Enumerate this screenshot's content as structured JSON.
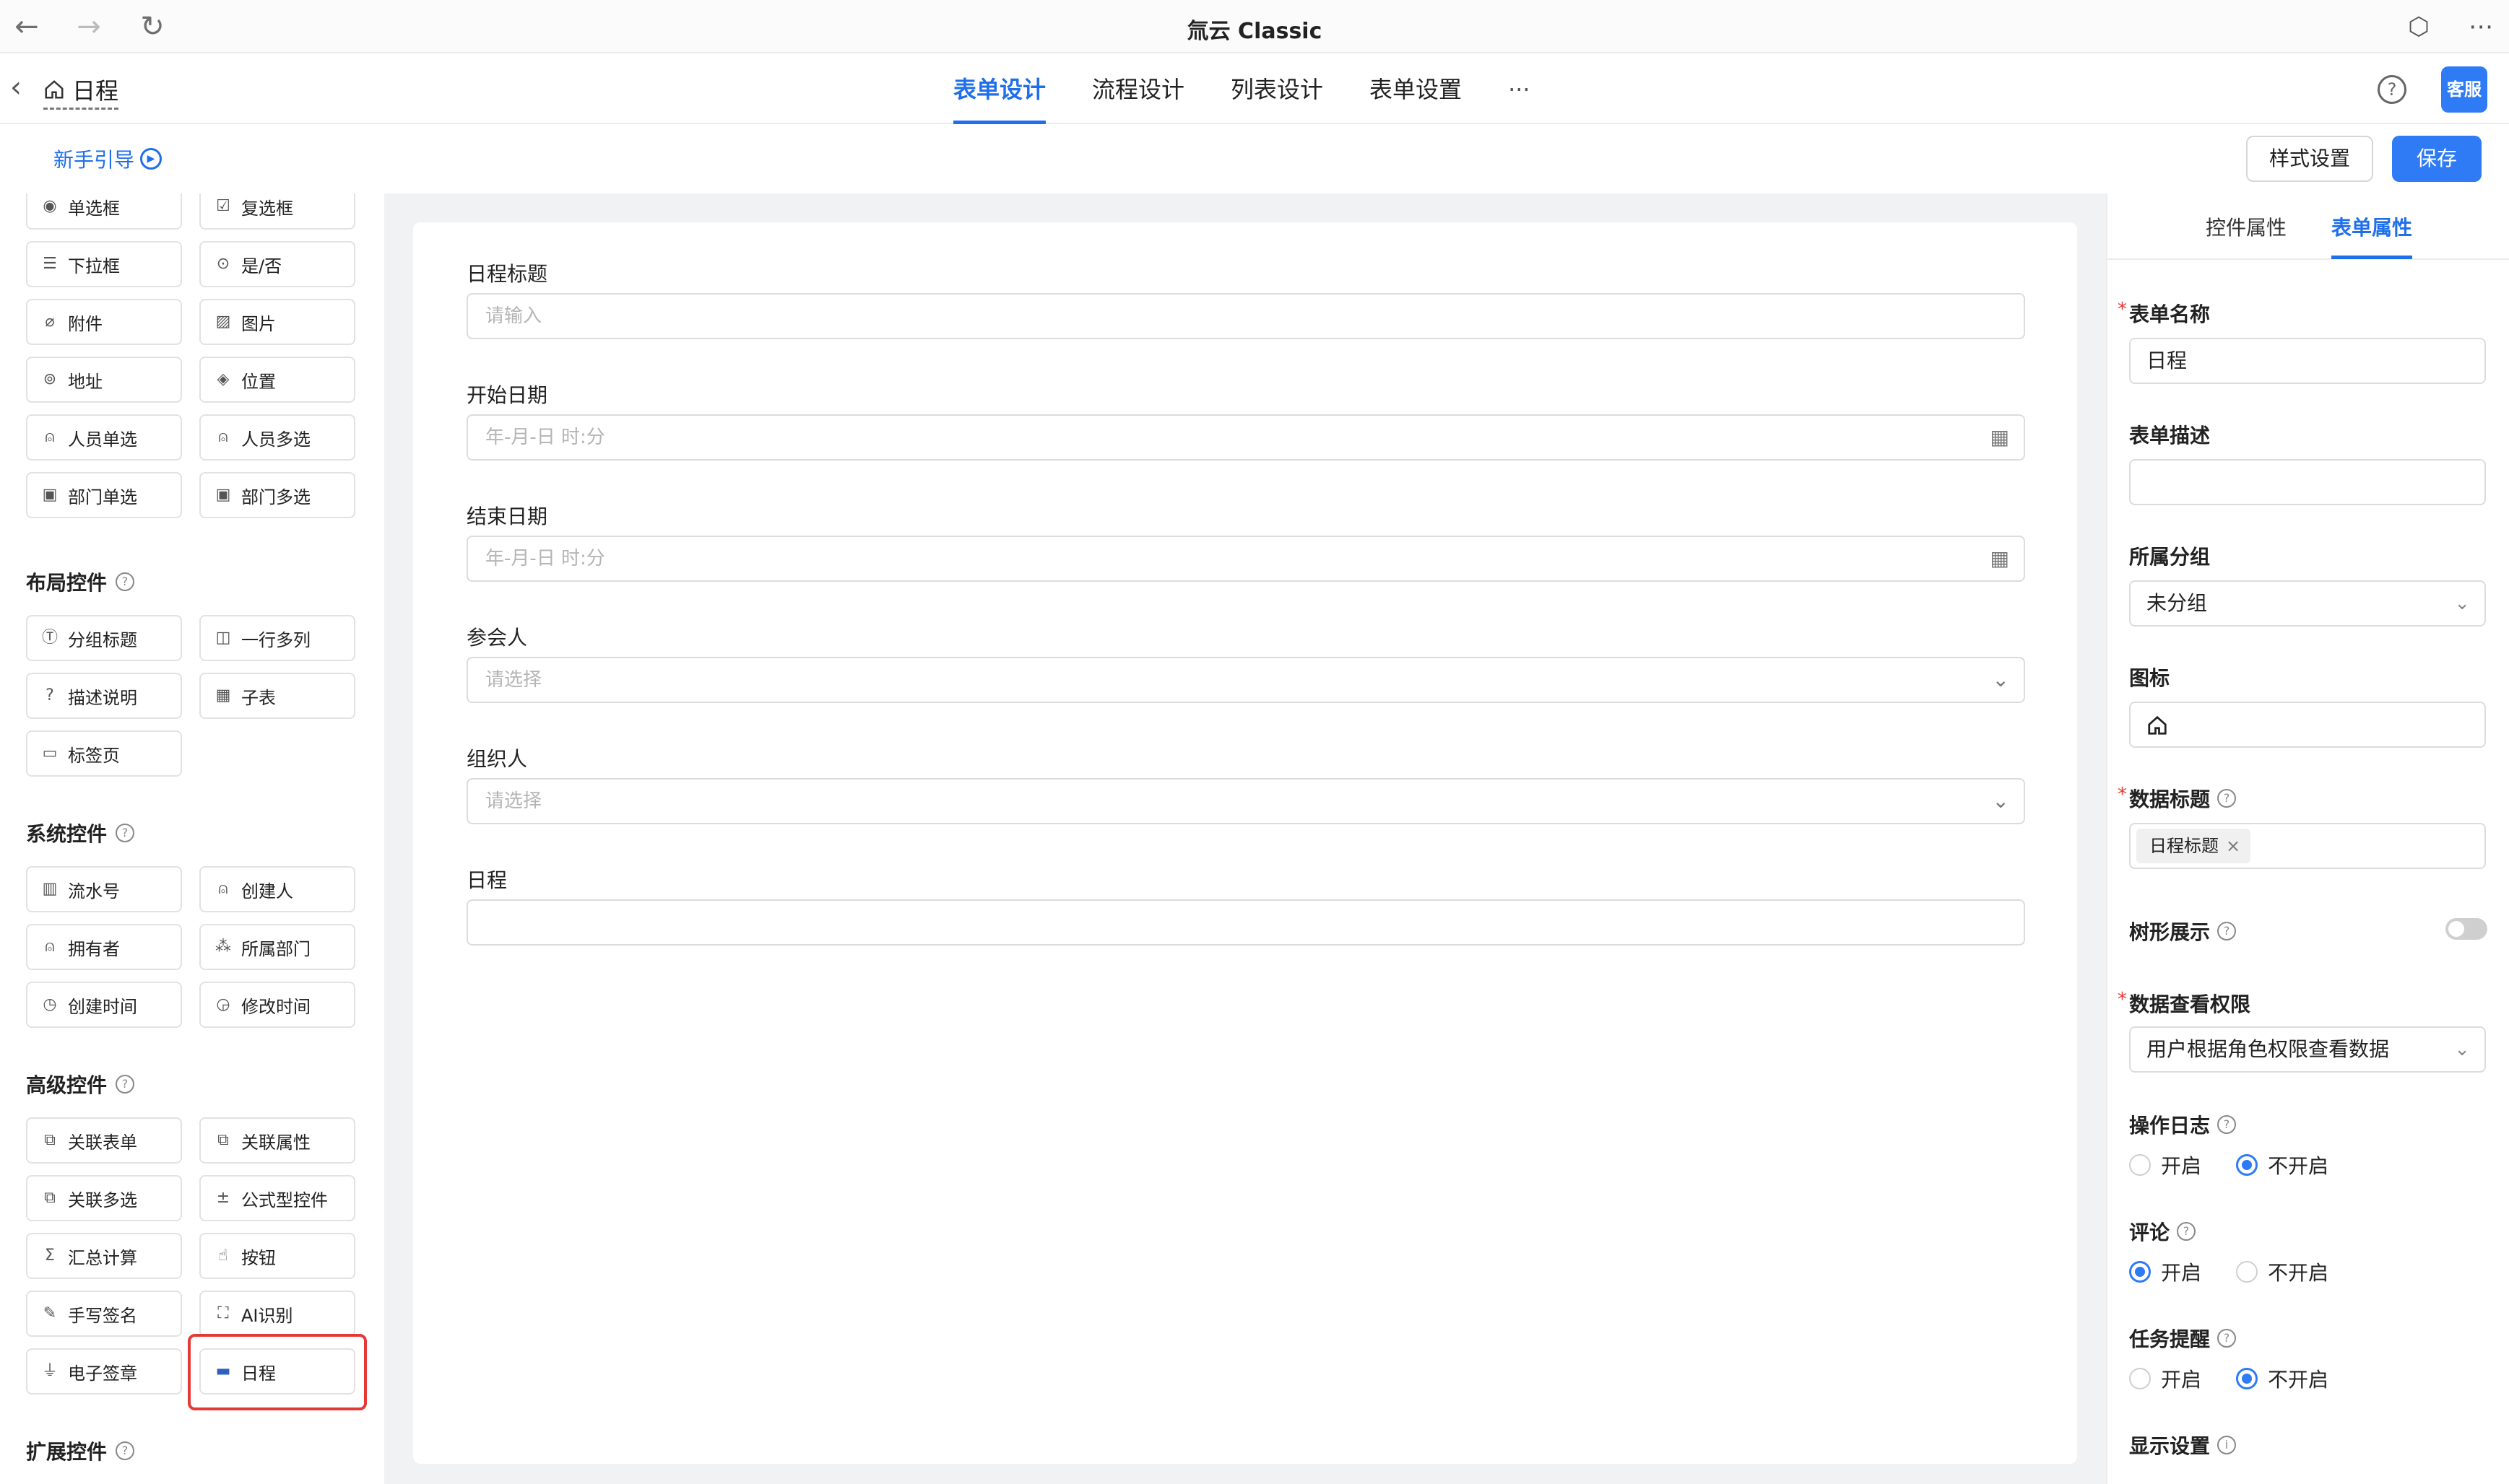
{
  "browser": {
    "title": "氚云 Classic",
    "back_icon": "←",
    "forward_icon": "→",
    "reload_icon": "↻",
    "extension_icon": "⬡",
    "more_icon": "⋯"
  },
  "header": {
    "breadcrumb": "日程",
    "tabs": [
      "表单设计",
      "流程设计",
      "列表设计",
      "表单设置",
      "···"
    ],
    "help": "?",
    "kefu": "客服"
  },
  "toolbar": {
    "guide": "新手引导",
    "style_settings": "样式设置",
    "save": "保存"
  },
  "palette": {
    "basic": [
      "单选框",
      "复选框",
      "下拉框",
      "是/否",
      "附件",
      "图片",
      "地址",
      "位置",
      "人员单选",
      "人员多选",
      "部门单选",
      "部门多选"
    ],
    "layout_title": "布局控件",
    "layout": [
      "分组标题",
      "一行多列",
      "描述说明",
      "子表",
      "标签页"
    ],
    "system_title": "系统控件",
    "system": [
      "流水号",
      "创建人",
      "拥有者",
      "所属部门",
      "创建时间",
      "修改时间"
    ],
    "advanced_title": "高级控件",
    "advanced": [
      "关联表单",
      "关联属性",
      "关联多选",
      "公式型控件",
      "汇总计算",
      "按钮",
      "手写签名",
      "AI识别",
      "电子签章",
      "日程"
    ],
    "extension_title": "扩展控件"
  },
  "form": {
    "fields": [
      {
        "label": "日程标题",
        "placeholder": "请输入"
      },
      {
        "label": "开始日期",
        "placeholder": "年-月-日 时:分"
      },
      {
        "label": "结束日期",
        "placeholder": "年-月-日 时:分"
      },
      {
        "label": "参会人",
        "placeholder": "请选择"
      },
      {
        "label": "组织人",
        "placeholder": "请选择"
      },
      {
        "label": "日程",
        "placeholder": ""
      }
    ]
  },
  "right_panel": {
    "tabs": [
      "控件属性",
      "表单属性"
    ],
    "form_name_label": "表单名称",
    "form_name_value": "日程",
    "form_desc_label": "表单描述",
    "form_desc_value": "",
    "group_label": "所属分组",
    "group_value": "未分组",
    "icon_label": "图标",
    "data_title_label": "数据标题",
    "data_title_tag": "日程标题",
    "tree_label": "树形展示",
    "tree_on": false,
    "permission_label": "数据查看权限",
    "permission_value": "用户根据角色权限查看数据",
    "log_label": "操作日志",
    "log_value": "不开启",
    "comment_label": "评论",
    "comment_value": "开启",
    "reminder_label": "任务提醒",
    "reminder_value": "不开启",
    "on_label": "开启",
    "off_label": "不开启",
    "display_label": "显示设置"
  }
}
